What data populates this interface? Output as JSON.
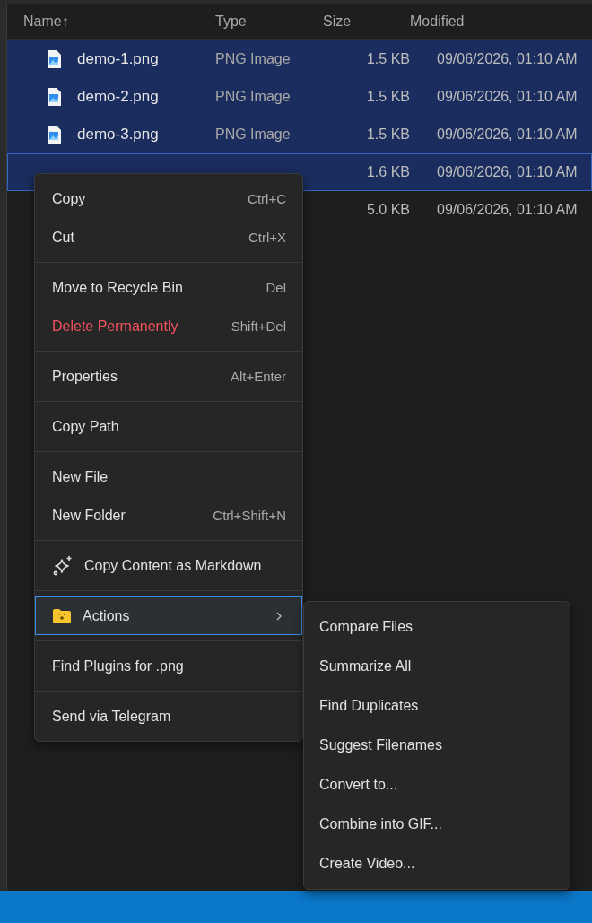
{
  "columns": [
    {
      "label": "Name",
      "sort_arrow": "↑"
    },
    {
      "label": "Type"
    },
    {
      "label": "Size"
    },
    {
      "label": "Modified"
    }
  ],
  "rows": [
    {
      "name": "demo-1.png",
      "type": "PNG Image",
      "size": "1.5 KB",
      "modified": "09/06/2026, 01:10 AM",
      "selected": true,
      "focused": false
    },
    {
      "name": "demo-2.png",
      "type": "PNG Image",
      "size": "1.5 KB",
      "modified": "09/06/2026, 01:10 AM",
      "selected": true,
      "focused": false
    },
    {
      "name": "demo-3.png",
      "type": "PNG Image",
      "size": "1.5 KB",
      "modified": "09/06/2026, 01:10 AM",
      "selected": true,
      "focused": false
    },
    {
      "size": "1.6 KB",
      "modified": "09/06/2026, 01:10 AM",
      "selected": true,
      "focused": true
    },
    {
      "size": "5.0 KB",
      "modified": "09/06/2026, 01:10 AM",
      "selected": false,
      "focused": false
    }
  ],
  "context_menu": {
    "groups": [
      [
        {
          "kind": "plain",
          "label": "Copy",
          "shortcut": "Ctrl+C",
          "danger": false,
          "highlighted": false
        },
        {
          "kind": "plain",
          "label": "Cut",
          "shortcut": "Ctrl+X",
          "danger": false,
          "highlighted": false
        }
      ],
      [
        {
          "kind": "plain",
          "label": "Move to Recycle Bin",
          "shortcut": "Del",
          "danger": false,
          "highlighted": false
        },
        {
          "kind": "plain",
          "label": "Delete Permanently",
          "shortcut": "Shift+Del",
          "danger": true,
          "highlighted": false
        }
      ],
      [
        {
          "kind": "plain",
          "label": "Properties",
          "shortcut": "Alt+Enter",
          "danger": false,
          "highlighted": false
        }
      ],
      [
        {
          "kind": "plain",
          "label": "Copy Path",
          "danger": false,
          "highlighted": false
        }
      ],
      [
        {
          "kind": "plain",
          "label": "New File",
          "danger": false,
          "highlighted": false
        },
        {
          "kind": "plain",
          "label": "New Folder",
          "shortcut": "Ctrl+Shift+N",
          "danger": false,
          "highlighted": false
        }
      ],
      [
        {
          "kind": "sparkle",
          "label": "Copy Content as Markdown",
          "danger": false,
          "highlighted": false
        }
      ],
      [
        {
          "kind": "submenu",
          "label": "Actions",
          "danger": false,
          "highlighted": true
        }
      ],
      [
        {
          "kind": "plain",
          "label": "Find Plugins for .png",
          "danger": false,
          "highlighted": false
        }
      ],
      [
        {
          "kind": "plain",
          "label": "Send via Telegram",
          "danger": false,
          "highlighted": false
        }
      ]
    ]
  },
  "submenu": {
    "items": [
      "Compare Files",
      "Summarize All",
      "Find Duplicates",
      "Suggest Filenames",
      "Convert to...",
      "Combine into GIF...",
      "Create Video..."
    ]
  }
}
